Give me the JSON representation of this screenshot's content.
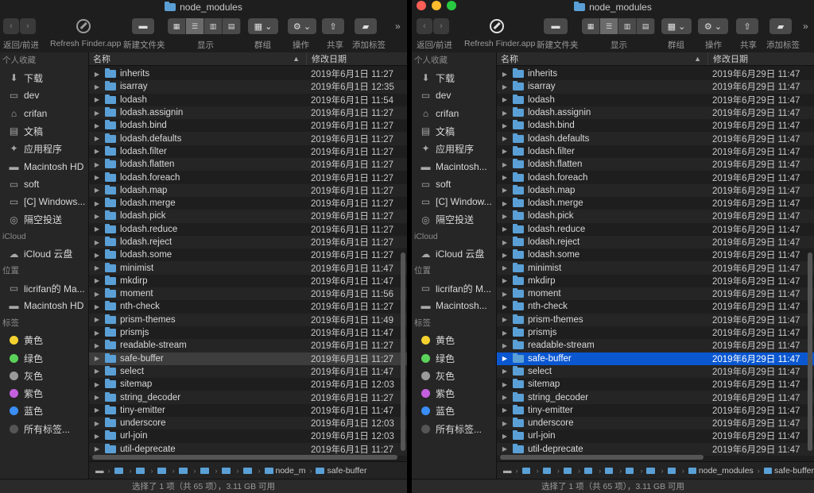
{
  "colors": {
    "close": "#ff5f57",
    "minimize": "#febc2e",
    "zoom": "#28c840",
    "folder": "#5aa0d6",
    "selection": "#0a57d0"
  },
  "windows": [
    {
      "title": "node_modules",
      "toolbar": {
        "back_forward": "返回/前进",
        "refresh": "Refresh Finder.app",
        "new_folder": "新建文件夹",
        "display": "显示",
        "group": "群组",
        "action": "操作",
        "share": "共享",
        "add_tag": "添加标签"
      },
      "sidebar": {
        "favorites_header": "个人收藏",
        "favorites": [
          {
            "label": "下载",
            "icon": "download-icon"
          },
          {
            "label": "dev",
            "icon": "folder-icon"
          },
          {
            "label": "crifan",
            "icon": "home-icon"
          },
          {
            "label": "文稿",
            "icon": "document-icon"
          },
          {
            "label": "应用程序",
            "icon": "applications-icon"
          },
          {
            "label": "Macintosh HD",
            "icon": "hard-drive-icon"
          },
          {
            "label": "soft",
            "icon": "folder-icon"
          },
          {
            "label": "[C] Windows...",
            "icon": "folder-icon"
          },
          {
            "label": "隔空投送",
            "icon": "airdrop-icon"
          }
        ],
        "icloud_header": "iCloud",
        "icloud": [
          {
            "label": "iCloud 云盘",
            "icon": "cloud-icon"
          }
        ],
        "locations_header": "位置",
        "locations": [
          {
            "label": "licrifan的 Ma...",
            "icon": "computer-icon"
          },
          {
            "label": "Macintosh HD",
            "icon": "hard-drive-icon"
          }
        ],
        "tags_header": "标签",
        "tags": [
          {
            "label": "黄色",
            "color": "#f5d130"
          },
          {
            "label": "绿色",
            "color": "#5bd35a"
          },
          {
            "label": "灰色",
            "color": "#9a9a9a"
          },
          {
            "label": "紫色",
            "color": "#c460de"
          },
          {
            "label": "蓝色",
            "color": "#3a8ef5"
          },
          {
            "label": "所有标签...",
            "color": "#555555"
          }
        ]
      },
      "columns": {
        "name": "名称",
        "date": "修改日期"
      },
      "rows": [
        {
          "name": "inherits",
          "date": "2019年6月1日 11:27"
        },
        {
          "name": "isarray",
          "date": "2019年6月1日 12:35"
        },
        {
          "name": "lodash",
          "date": "2019年6月1日 11:54"
        },
        {
          "name": "lodash.assignin",
          "date": "2019年6月1日 11:27"
        },
        {
          "name": "lodash.bind",
          "date": "2019年6月1日 11:27"
        },
        {
          "name": "lodash.defaults",
          "date": "2019年6月1日 11:27"
        },
        {
          "name": "lodash.filter",
          "date": "2019年6月1日 11:27"
        },
        {
          "name": "lodash.flatten",
          "date": "2019年6月1日 11:27"
        },
        {
          "name": "lodash.foreach",
          "date": "2019年6月1日 11:27"
        },
        {
          "name": "lodash.map",
          "date": "2019年6月1日 11:27"
        },
        {
          "name": "lodash.merge",
          "date": "2019年6月1日 11:27"
        },
        {
          "name": "lodash.pick",
          "date": "2019年6月1日 11:27"
        },
        {
          "name": "lodash.reduce",
          "date": "2019年6月1日 11:27"
        },
        {
          "name": "lodash.reject",
          "date": "2019年6月1日 11:27"
        },
        {
          "name": "lodash.some",
          "date": "2019年6月1日 11:27"
        },
        {
          "name": "minimist",
          "date": "2019年6月1日 11:47"
        },
        {
          "name": "mkdirp",
          "date": "2019年6月1日 11:47"
        },
        {
          "name": "moment",
          "date": "2019年6月1日 11:56"
        },
        {
          "name": "nth-check",
          "date": "2019年6月1日 11:27"
        },
        {
          "name": "prism-themes",
          "date": "2019年6月1日 11:49"
        },
        {
          "name": "prismjs",
          "date": "2019年6月1日 11:47"
        },
        {
          "name": "readable-stream",
          "date": "2019年6月1日 11:27"
        },
        {
          "name": "safe-buffer",
          "date": "2019年6月1日 11:27"
        },
        {
          "name": "select",
          "date": "2019年6月1日 11:47"
        },
        {
          "name": "sitemap",
          "date": "2019年6月1日 12:03"
        },
        {
          "name": "string_decoder",
          "date": "2019年6月1日 11:27"
        },
        {
          "name": "tiny-emitter",
          "date": "2019年6月1日 11:47"
        },
        {
          "name": "underscore",
          "date": "2019年6月1日 12:03"
        },
        {
          "name": "url-join",
          "date": "2019年6月1日 12:03"
        },
        {
          "name": "util-deprecate",
          "date": "2019年6月1日 11:27"
        }
      ],
      "selected_index": 22,
      "path": [
        "node_m",
        "safe-buffer"
      ],
      "status": "选择了 1 项（共 65 项），3.11 GB 可用"
    },
    {
      "title": "node_modules",
      "toolbar": {
        "back_forward": "返回/前进",
        "refresh": "Refresh Finder.app",
        "new_folder": "新建文件夹",
        "display": "显示",
        "group": "群组",
        "action": "操作",
        "share": "共享",
        "add_tag": "添加标签"
      },
      "sidebar": {
        "favorites_header": "个人收藏",
        "favorites": [
          {
            "label": "下载",
            "icon": "download-icon"
          },
          {
            "label": "dev",
            "icon": "folder-icon"
          },
          {
            "label": "crifan",
            "icon": "home-icon"
          },
          {
            "label": "文稿",
            "icon": "document-icon"
          },
          {
            "label": "应用程序",
            "icon": "applications-icon"
          },
          {
            "label": "Macintosh...",
            "icon": "hard-drive-icon"
          },
          {
            "label": "soft",
            "icon": "folder-icon"
          },
          {
            "label": "[C] Window...",
            "icon": "folder-icon"
          },
          {
            "label": "隔空投送",
            "icon": "airdrop-icon"
          }
        ],
        "icloud_header": "iCloud",
        "icloud": [
          {
            "label": "iCloud 云盘",
            "icon": "cloud-icon"
          }
        ],
        "locations_header": "位置",
        "locations": [
          {
            "label": "licrifan的 M...",
            "icon": "computer-icon"
          },
          {
            "label": "Macintosh...",
            "icon": "hard-drive-icon"
          }
        ],
        "tags_header": "标签",
        "tags": [
          {
            "label": "黄色",
            "color": "#f5d130"
          },
          {
            "label": "绿色",
            "color": "#5bd35a"
          },
          {
            "label": "灰色",
            "color": "#9a9a9a"
          },
          {
            "label": "紫色",
            "color": "#c460de"
          },
          {
            "label": "蓝色",
            "color": "#3a8ef5"
          },
          {
            "label": "所有标签...",
            "color": "#555555"
          }
        ]
      },
      "columns": {
        "name": "名称",
        "date": "修改日期"
      },
      "rows": [
        {
          "name": "inherits",
          "date": "2019年6月29日 11:47"
        },
        {
          "name": "isarray",
          "date": "2019年6月29日 11:47"
        },
        {
          "name": "lodash",
          "date": "2019年6月29日 11:47"
        },
        {
          "name": "lodash.assignin",
          "date": "2019年6月29日 11:47"
        },
        {
          "name": "lodash.bind",
          "date": "2019年6月29日 11:47"
        },
        {
          "name": "lodash.defaults",
          "date": "2019年6月29日 11:47"
        },
        {
          "name": "lodash.filter",
          "date": "2019年6月29日 11:47"
        },
        {
          "name": "lodash.flatten",
          "date": "2019年6月29日 11:47"
        },
        {
          "name": "lodash.foreach",
          "date": "2019年6月29日 11:47"
        },
        {
          "name": "lodash.map",
          "date": "2019年6月29日 11:47"
        },
        {
          "name": "lodash.merge",
          "date": "2019年6月29日 11:47"
        },
        {
          "name": "lodash.pick",
          "date": "2019年6月29日 11:47"
        },
        {
          "name": "lodash.reduce",
          "date": "2019年6月29日 11:47"
        },
        {
          "name": "lodash.reject",
          "date": "2019年6月29日 11:47"
        },
        {
          "name": "lodash.some",
          "date": "2019年6月29日 11:47"
        },
        {
          "name": "minimist",
          "date": "2019年6月29日 11:47"
        },
        {
          "name": "mkdirp",
          "date": "2019年6月29日 11:47"
        },
        {
          "name": "moment",
          "date": "2019年6月29日 11:47"
        },
        {
          "name": "nth-check",
          "date": "2019年6月29日 11:47"
        },
        {
          "name": "prism-themes",
          "date": "2019年6月29日 11:47"
        },
        {
          "name": "prismjs",
          "date": "2019年6月29日 11:47"
        },
        {
          "name": "readable-stream",
          "date": "2019年6月29日 11:47"
        },
        {
          "name": "safe-buffer",
          "date": "2019年6月29日 11:47"
        },
        {
          "name": "select",
          "date": "2019年6月29日 11:47"
        },
        {
          "name": "sitemap",
          "date": "2019年6月29日 11:47"
        },
        {
          "name": "string_decoder",
          "date": "2019年6月29日 11:47"
        },
        {
          "name": "tiny-emitter",
          "date": "2019年6月29日 11:47"
        },
        {
          "name": "underscore",
          "date": "2019年6月29日 11:47"
        },
        {
          "name": "url-join",
          "date": "2019年6月29日 11:47"
        },
        {
          "name": "util-deprecate",
          "date": "2019年6月29日 11:47"
        }
      ],
      "selected_index": 22,
      "path": [
        "node_modules",
        "safe-buffer"
      ],
      "status": "选择了 1 项（共 65 项），3.11 GB 可用"
    }
  ]
}
